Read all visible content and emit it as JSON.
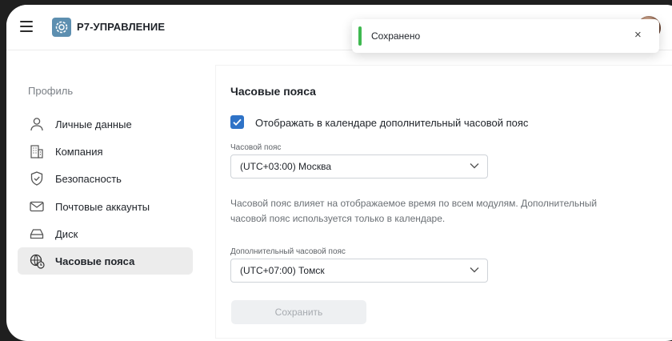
{
  "header": {
    "app_title": "Р7-УПРАВЛЕНИЕ",
    "dots": "•••"
  },
  "toast": {
    "message": "Сохранено",
    "close_label": "×"
  },
  "sidebar": {
    "heading": "Профиль",
    "items": [
      {
        "label": "Личные данные",
        "icon": "user-icon"
      },
      {
        "label": "Компания",
        "icon": "building-icon"
      },
      {
        "label": "Безопасность",
        "icon": "shield-icon"
      },
      {
        "label": "Почтовые аккаунты",
        "icon": "mail-icon"
      },
      {
        "label": "Диск",
        "icon": "disk-icon"
      },
      {
        "label": "Часовые пояса",
        "icon": "globe-clock-icon",
        "active": true
      }
    ]
  },
  "main": {
    "title": "Часовые пояса",
    "checkbox": {
      "label": "Отображать в календаре дополнительный часовой пояс",
      "checked": true
    },
    "timezone": {
      "label": "Часовой пояс",
      "value": "(UTC+03:00) Москва"
    },
    "hint": "Часовой пояс влияет на отображаемое время по всем модулям. Дополнительный часовой пояс используется только в календаре.",
    "extra_timezone": {
      "label": "Дополнительный часовой пояс",
      "value": "(UTC+07:00) Томск"
    },
    "save_button": "Сохранить"
  },
  "colors": {
    "accent": "#2f73c7",
    "success": "#3fb950",
    "active_bg": "#ececec"
  }
}
